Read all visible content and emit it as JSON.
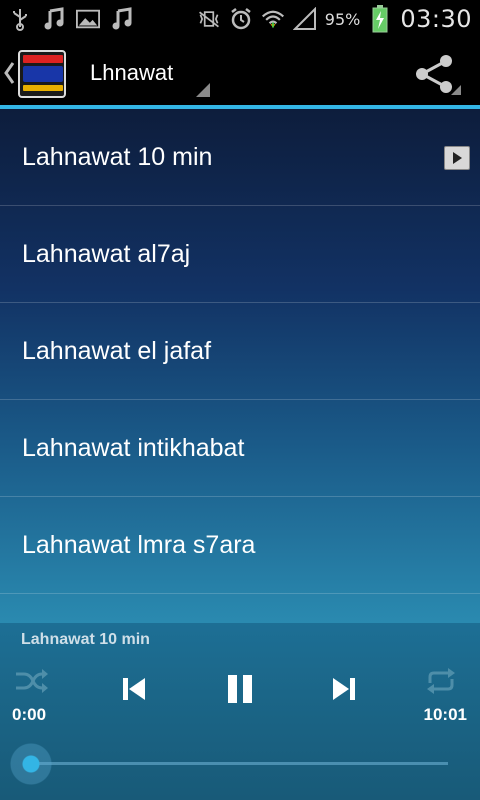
{
  "status_bar": {
    "left_icons": [
      "usb-icon",
      "music-note-icon",
      "image-icon",
      "music-note-icon"
    ],
    "right_icons": [
      "vibrate-mute-icon",
      "alarm-icon",
      "wifi-icon",
      "signal-icon"
    ],
    "battery_percent": "95%",
    "battery_charging": true,
    "time": "03:30"
  },
  "action_bar": {
    "app_title": "Lhnawat",
    "share_icon": "share-icon"
  },
  "tracks": [
    {
      "label": "Lahnawat 10 min",
      "playing": true
    },
    {
      "label": "Lahnawat al7aj",
      "playing": false
    },
    {
      "label": "Lahnawat el jafaf",
      "playing": false
    },
    {
      "label": "Lahnawat intikhabat",
      "playing": false
    },
    {
      "label": "Lahnawat lmra s7ara",
      "playing": false
    }
  ],
  "player": {
    "now_playing": "Lahnawat 10 min",
    "current_time": "0:00",
    "duration": "10:01",
    "progress": 0.0,
    "controls": [
      "shuffle-icon",
      "previous-icon",
      "pause-icon",
      "next-icon",
      "repeat-icon"
    ]
  },
  "colors": {
    "accent": "#33b5e5",
    "list_top": "#0d1d3c",
    "list_bottom": "#2a8ab0",
    "player_bg": "#1b6688"
  }
}
